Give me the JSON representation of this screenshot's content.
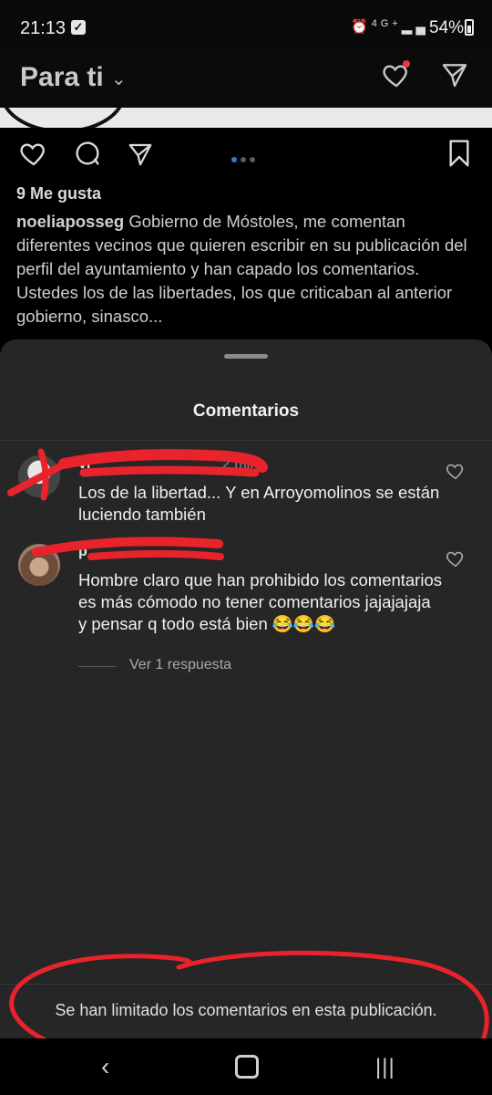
{
  "status_bar": {
    "time": "21:13",
    "network": "4G+",
    "battery": "54%"
  },
  "header": {
    "title": "Para ti",
    "chevron": "⌄"
  },
  "post": {
    "likes": "9 Me gusta",
    "caption_user": "noeliaposseg",
    "caption_text": " Gobierno de Móstoles, me comentan diferentes vecinos que quieren escribir en su publicación del perfil del ayuntamiento y han capado los comentarios.",
    "caption_text_2": "Ustedes los de las libertades, los que criticaban al anterior gobierno, sinasco..."
  },
  "comments_sheet": {
    "title": "Comentarios",
    "comments": [
      {
        "user": "vi",
        "time": "2 min",
        "text": "Los de la libertad... Y en Arroyomolinos se están luciendo también"
      },
      {
        "user": "p",
        "text": "Hombre claro que han prohibido los comentarios es más cómodo no tener comentarios jajajajaja y pensar q todo está bien 😂😂😂",
        "replies_label": "Ver 1 respuesta"
      }
    ],
    "limited_notice": "Se han limitado los comentarios en esta publicación."
  },
  "nav": {
    "back": "‹",
    "recents": "|||"
  },
  "colors": {
    "sheet_bg": "#262626",
    "annotation_red": "#e8232b",
    "notification_dot": "#e8364a"
  }
}
